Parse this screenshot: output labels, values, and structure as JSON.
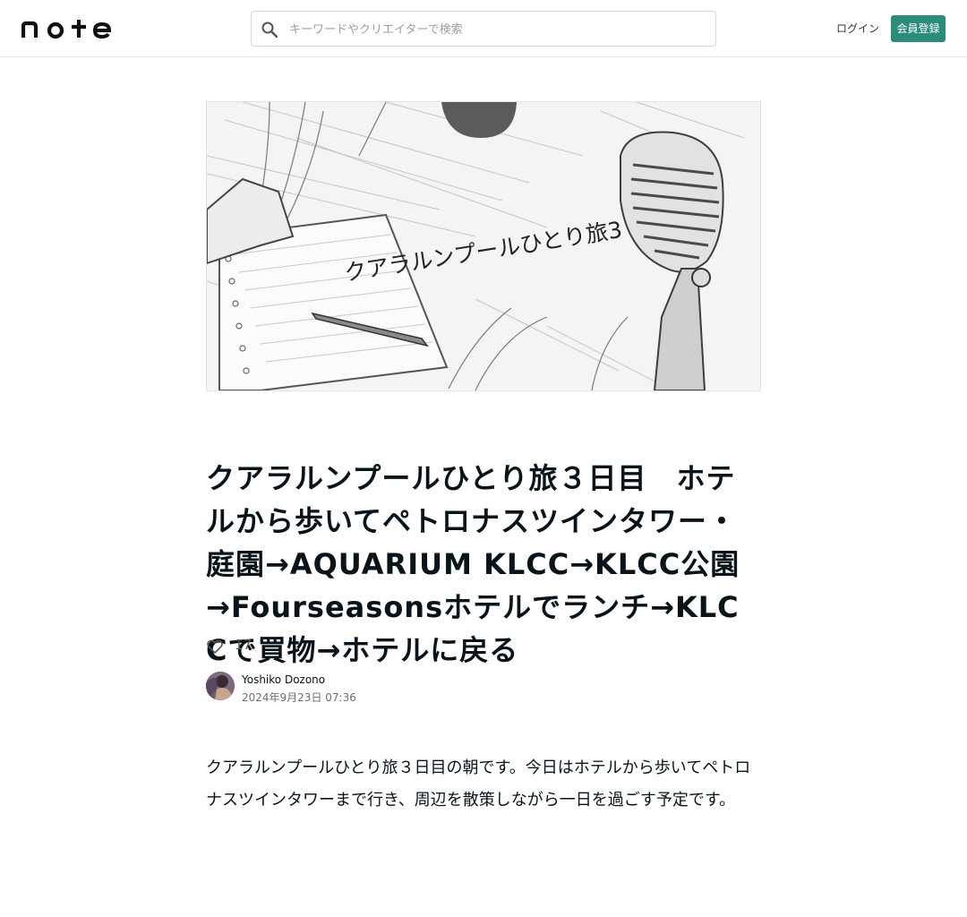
{
  "header": {
    "logo_text": "note",
    "search": {
      "placeholder": "キーワードやクリエイターで検索"
    },
    "login_label": "ログイン",
    "signup_label": "会員登録"
  },
  "article": {
    "cover": {
      "caption": "クアラルンプールひとり旅3"
    },
    "title": "クアラルンプールひとり旅３日目　ホテルから歩いてペトロナスツインタワー・庭園→AQUARIUM KLCC→KLCC公園→Fourseasonsホテルでランチ→KLCCで買物→ホテルに戻る",
    "likes": "17",
    "author": {
      "name": "Yoshiko Dozono"
    },
    "published": "2024年9月23日 07:36",
    "body": "クアラルンプールひとり旅３日目の朝です。今日はホテルから歩いてペトロナスツインタワーまで行き、周辺を散策しながら一日を過ごす予定です。"
  },
  "colors": {
    "accent": "#2a8d7c",
    "text": "#08131a"
  }
}
